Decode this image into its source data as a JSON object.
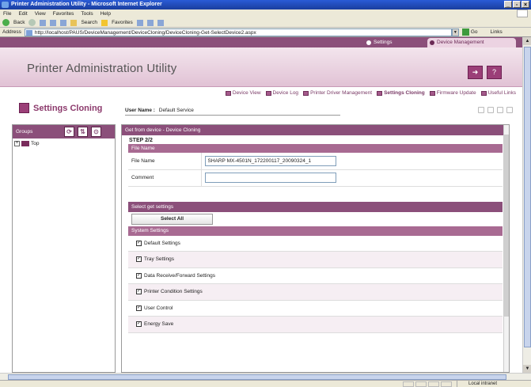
{
  "browser": {
    "title": "Printer Administration Utility - Microsoft Internet Explorer",
    "menus": [
      "File",
      "Edit",
      "View",
      "Favorites",
      "Tools",
      "Help"
    ],
    "toolbar": {
      "back": "Back",
      "search": "Search",
      "favorites": "Favorites"
    },
    "address_label": "Address",
    "address_url": "http://localhost/PAUS/DeviceManagement/DeviceCloning/DeviceCloning-Get-SelectDevice2.aspx",
    "go_label": "Go",
    "links_label": "Links",
    "status_zone": "Local intranet"
  },
  "nav": {
    "settings": "Settings",
    "device_management": "Device Management"
  },
  "app": {
    "title": "Printer Administration Utility"
  },
  "links": [
    {
      "label": "Device View",
      "bold": false
    },
    {
      "label": "Device Log",
      "bold": false
    },
    {
      "label": "Printer Driver Management",
      "bold": false
    },
    {
      "label": "Settings Cloning",
      "bold": true
    },
    {
      "label": "Firmware Update",
      "bold": false
    },
    {
      "label": "Useful Links",
      "bold": false
    }
  ],
  "page": {
    "section_title": "Settings Cloning",
    "username_label": "User Name :",
    "username_value": "Default Service"
  },
  "groups": {
    "header": "Groups",
    "tree": [
      {
        "label": "Top"
      }
    ]
  },
  "panel": {
    "header": "Get from device - Device Cloning",
    "step": "STEP 2/2",
    "file_section": "File Name",
    "file_name_label": "File Name",
    "file_name_value": "SHARP MX-4501N_172200117_20090324_1",
    "comment_label": "Comment",
    "comment_value": "",
    "select_section": "Select get settings",
    "select_all": "Select All",
    "system_settings": "System Settings",
    "items": [
      {
        "label": "Default Settings",
        "checked": true
      },
      {
        "label": "Tray Settings",
        "checked": true
      },
      {
        "label": "Data Receive/Forward Settings",
        "checked": true
      },
      {
        "label": "Printer Condition Settings",
        "checked": true
      },
      {
        "label": "User Control",
        "checked": true
      },
      {
        "label": "Energy Save",
        "checked": true
      }
    ]
  },
  "colors": {
    "accent": "#8b4f7a",
    "accent_light": "#a86a92",
    "header_bg": "#e8cedd"
  }
}
